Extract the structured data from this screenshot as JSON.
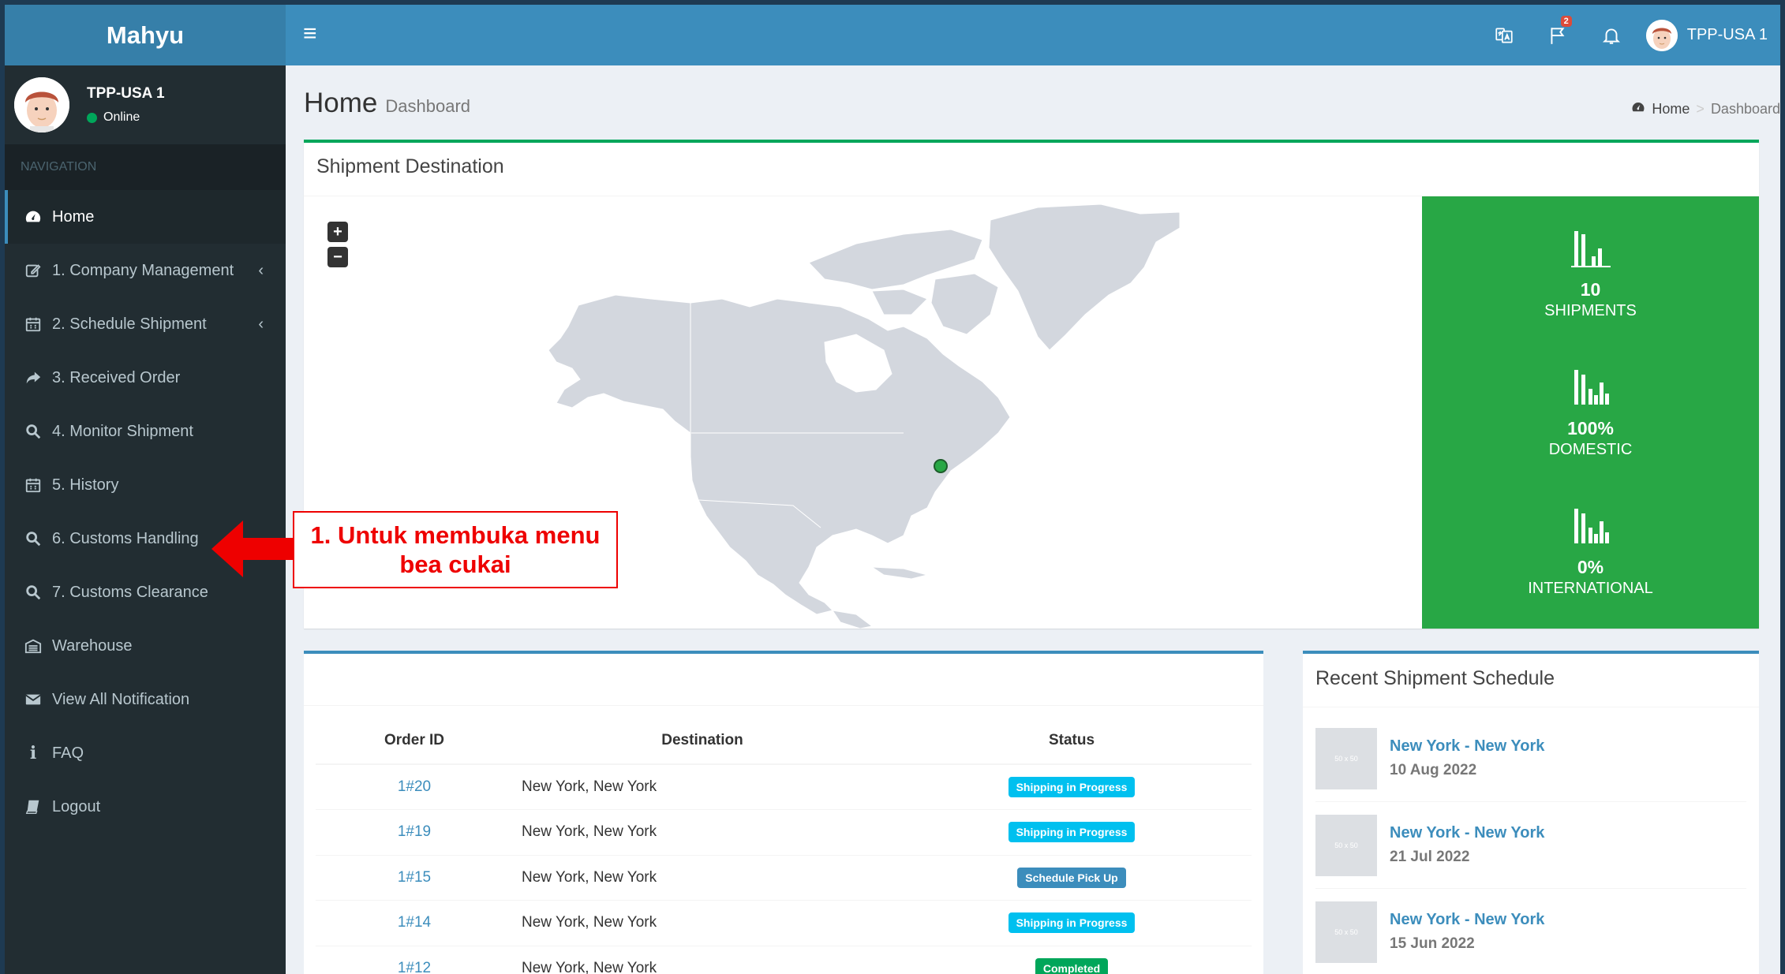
{
  "app": {
    "brand": "Mahyu"
  },
  "topbar": {
    "notification_count": "2",
    "user_name": "TPP-USA 1"
  },
  "sidebar": {
    "user": {
      "name": "TPP-USA 1",
      "status": "Online"
    },
    "nav_header": "NAVIGATION",
    "items": [
      {
        "label": "Home",
        "icon": "dashboard-icon"
      },
      {
        "label": "1. Company Management",
        "icon": "edit-icon"
      },
      {
        "label": "2. Schedule Shipment",
        "icon": "calendar-icon"
      },
      {
        "label": "3. Received Order",
        "icon": "share-icon"
      },
      {
        "label": "4. Monitor Shipment",
        "icon": "search-icon"
      },
      {
        "label": "5. History",
        "icon": "calendar-icon"
      },
      {
        "label": "6. Customs Handling",
        "icon": "search-icon"
      },
      {
        "label": "7. Customs Clearance",
        "icon": "search-icon"
      },
      {
        "label": "Warehouse",
        "icon": "warehouse-icon"
      },
      {
        "label": "View All Notification",
        "icon": "envelope-icon"
      },
      {
        "label": "FAQ",
        "icon": "info-icon"
      },
      {
        "label": "Logout",
        "icon": "book-icon"
      }
    ]
  },
  "page": {
    "title": "Home",
    "subtitle": "Dashboard",
    "breadcrumb": {
      "home": "Home",
      "separator": ">",
      "current": "Dashboard"
    }
  },
  "map_box": {
    "title": "Shipment Destination",
    "zoom_in": "+",
    "zoom_out": "−",
    "stats": [
      {
        "value": "10",
        "label": "SHIPMENTS"
      },
      {
        "value": "100%",
        "label": "DOMESTIC"
      },
      {
        "value": "0%",
        "label": "INTERNATIONAL"
      }
    ]
  },
  "orders": {
    "headers": {
      "order_id": "Order ID",
      "destination": "Destination",
      "status": "Status"
    },
    "rows": [
      {
        "order_id": "1#20",
        "destination": "New York, New York",
        "status": "Shipping in Progress",
        "status_color": "#00c0ef"
      },
      {
        "order_id": "1#19",
        "destination": "New York, New York",
        "status": "Shipping in Progress",
        "status_color": "#00c0ef"
      },
      {
        "order_id": "1#15",
        "destination": "New York, New York",
        "status": "Schedule Pick Up",
        "status_color": "#3c8dbc"
      },
      {
        "order_id": "1#14",
        "destination": "New York, New York",
        "status": "Shipping in Progress",
        "status_color": "#00c0ef"
      },
      {
        "order_id": "1#12",
        "destination": "New York, New York",
        "status": "Completed",
        "status_color": "#00a65a"
      }
    ]
  },
  "recent": {
    "title": "Recent Shipment Schedule",
    "thumb_text": "50 x 50",
    "items": [
      {
        "route": "New York - New York",
        "date": "10 Aug 2022"
      },
      {
        "route": "New York - New York",
        "date": "21 Jul 2022"
      },
      {
        "route": "New York - New York",
        "date": "15 Jun 2022"
      }
    ]
  },
  "annotation": {
    "line1": "1. Untuk membuka menu",
    "line2": "bea cukai"
  },
  "colors": {
    "header": "#3c8dbc",
    "logo_bg": "#367fa9",
    "sidebar": "#222d32",
    "stats_green": "#28a745",
    "annotation_red": "#ee0000"
  }
}
